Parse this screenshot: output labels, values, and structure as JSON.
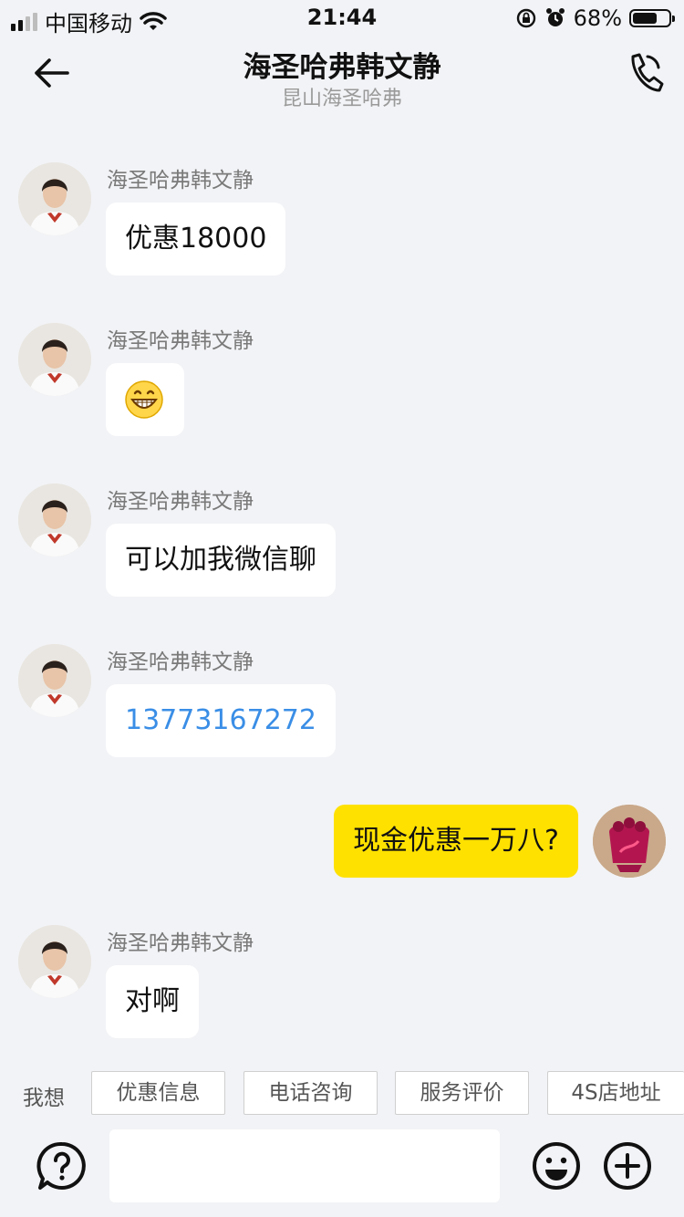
{
  "status_bar": {
    "carrier": "中国移动",
    "time": "21:44",
    "battery": "68%",
    "battery_level": 0.68
  },
  "header": {
    "title": "海圣哈弗韩文静",
    "subtitle": "昆山海圣哈弗"
  },
  "messages": [
    {
      "sender": "海圣哈弗韩文静",
      "text": "优惠18000",
      "side": "left"
    },
    {
      "sender": "海圣哈弗韩文静",
      "text": "",
      "side": "left",
      "emoji": "grinning-face"
    },
    {
      "sender": "海圣哈弗韩文静",
      "text": "可以加我微信聊",
      "side": "left"
    },
    {
      "sender": "海圣哈弗韩文静",
      "text": "13773167272",
      "side": "left",
      "link": true
    },
    {
      "sender": "",
      "text": "现金优惠一万八?",
      "side": "right"
    },
    {
      "sender": "海圣哈弗韩文静",
      "text": "对啊",
      "side": "left"
    }
  ],
  "quick_reply": {
    "label": "我想",
    "chips": [
      "优惠信息",
      "电话咨询",
      "服务评价",
      "4S店地址"
    ]
  },
  "colors": {
    "background": "#f2f3f6",
    "my_bubble": "#ffe100",
    "link": "#3a8ee6"
  }
}
